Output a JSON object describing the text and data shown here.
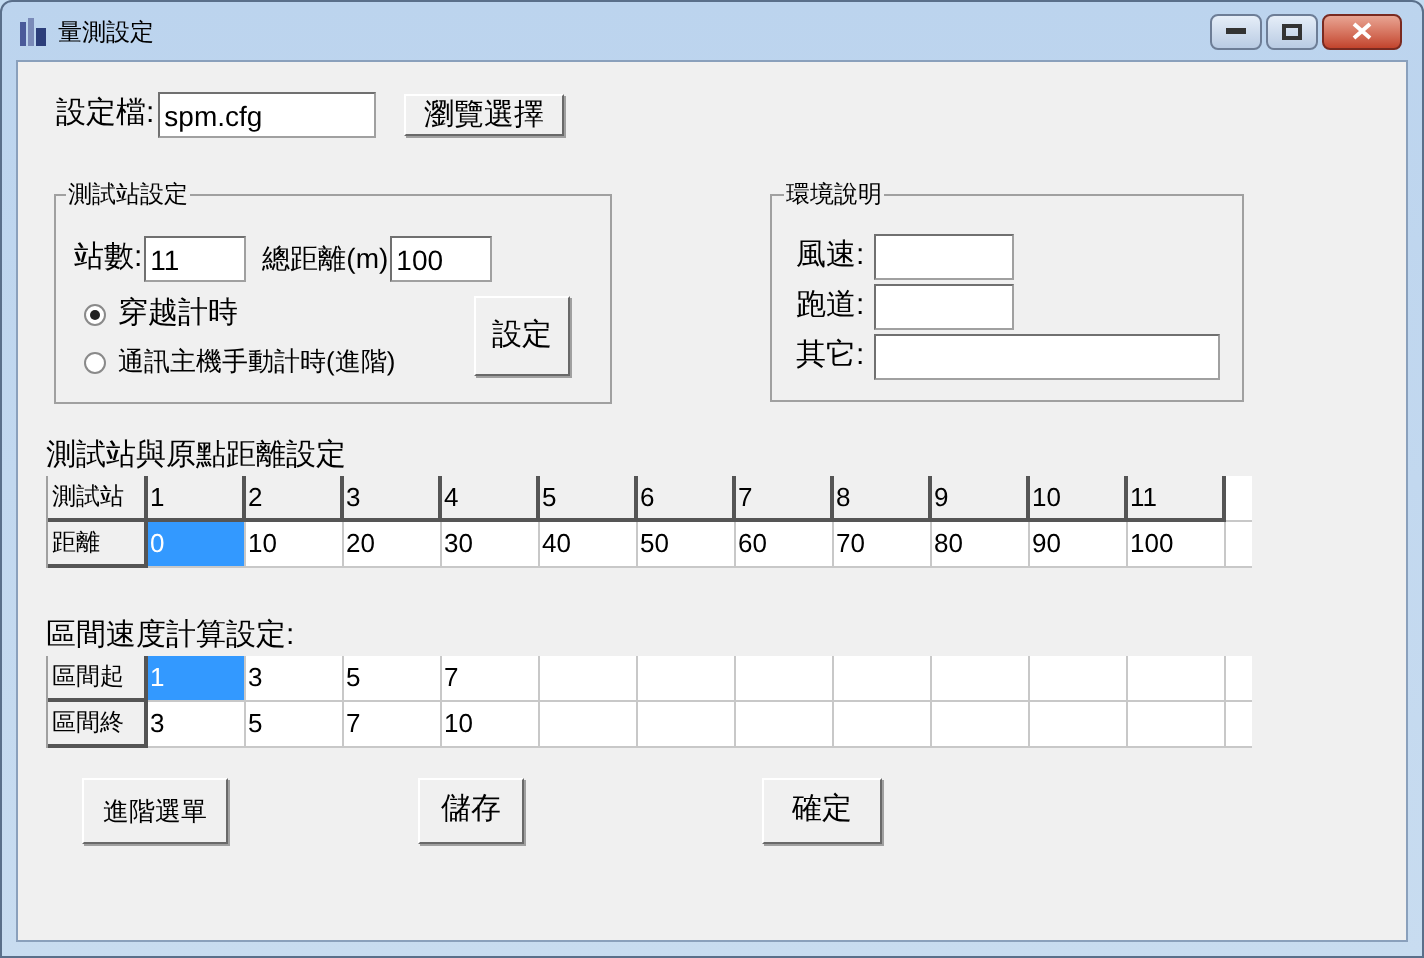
{
  "window": {
    "title": "量測設定"
  },
  "config_file": {
    "label": "設定檔:",
    "value": "spm.cfg",
    "browse_button": "瀏覽選擇"
  },
  "station_group": {
    "title": "測試站設定",
    "count_label": "站數:",
    "count_value": "11",
    "distance_label": "總距離(m)",
    "distance_value": "100",
    "radios": [
      {
        "label": "穿越計時",
        "selected": true
      },
      {
        "label": "通訊主機手動計時(進階)",
        "selected": false
      }
    ],
    "set_button": "設定"
  },
  "env_group": {
    "title": "環境說明",
    "fields": [
      {
        "label": "風速:"
      },
      {
        "label": "跑道:"
      },
      {
        "label": "其它:"
      }
    ]
  },
  "distance_grid": {
    "title": "測試站與原點距離設定",
    "rows": [
      {
        "header": "測試站",
        "kind": "header",
        "cells": [
          {
            "text": "1",
            "selected": false
          },
          {
            "text": "2",
            "selected": false
          },
          {
            "text": "3",
            "selected": false
          },
          {
            "text": "4",
            "selected": false
          },
          {
            "text": "5",
            "selected": false
          },
          {
            "text": "6",
            "selected": false
          },
          {
            "text": "7",
            "selected": false
          },
          {
            "text": "8",
            "selected": false
          },
          {
            "text": "9",
            "selected": false
          },
          {
            "text": "10",
            "selected": false
          },
          {
            "text": "11",
            "selected": false
          }
        ]
      },
      {
        "header": "距離",
        "kind": "data",
        "cells": [
          {
            "text": "0",
            "selected": true
          },
          {
            "text": "10",
            "selected": false
          },
          {
            "text": "20",
            "selected": false
          },
          {
            "text": "30",
            "selected": false
          },
          {
            "text": "40",
            "selected": false
          },
          {
            "text": "50",
            "selected": false
          },
          {
            "text": "60",
            "selected": false
          },
          {
            "text": "70",
            "selected": false
          },
          {
            "text": "80",
            "selected": false
          },
          {
            "text": "90",
            "selected": false
          },
          {
            "text": "100",
            "selected": false
          }
        ]
      }
    ]
  },
  "interval_grid": {
    "title": "區間速度計算設定:",
    "rows": [
      {
        "header": "區間起",
        "cells": [
          {
            "text": "1",
            "selected": true
          },
          {
            "text": "3",
            "selected": false
          },
          {
            "text": "5",
            "selected": false
          },
          {
            "text": "7",
            "selected": false
          }
        ]
      },
      {
        "header": "區間終",
        "cells": [
          {
            "text": "3",
            "selected": false
          },
          {
            "text": "5",
            "selected": false
          },
          {
            "text": "7",
            "selected": false
          },
          {
            "text": "10",
            "selected": false
          }
        ]
      }
    ]
  },
  "buttons": [
    "進階選單",
    "儲存",
    "確定"
  ]
}
